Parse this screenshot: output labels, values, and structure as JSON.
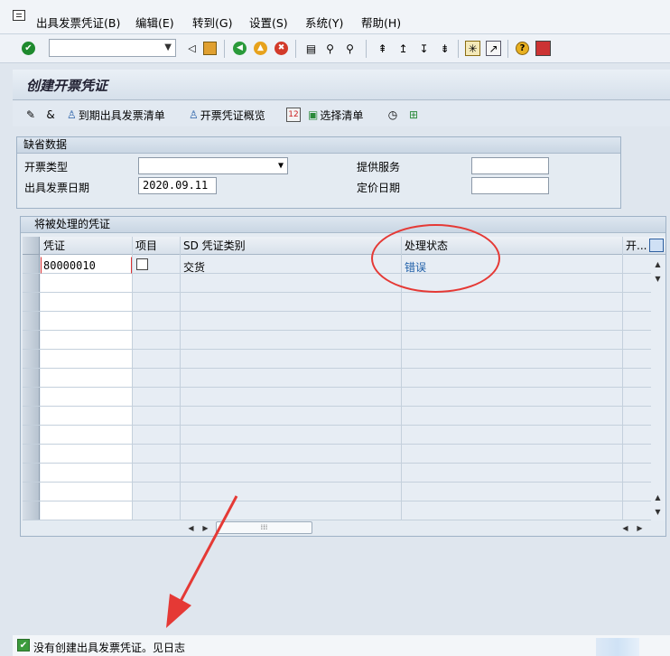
{
  "menu": {
    "items": [
      "出具发票凭证(B)",
      "编辑(E)",
      "转到(G)",
      "设置(S)",
      "系统(Y)",
      "帮助(H)"
    ]
  },
  "system_toolbar": {
    "command_field": "",
    "icons": [
      "enter-icon",
      "back-arrow-icon",
      "save-icon",
      "back-icon",
      "exit-icon",
      "cancel-icon",
      "print-icon",
      "find-icon",
      "find-next-icon",
      "first-page-icon",
      "prev-page-icon",
      "next-page-icon",
      "last-page-icon",
      "new-session-icon",
      "shortcut-icon",
      "help-icon",
      "layout-icon"
    ]
  },
  "title": "创建开票凭证",
  "app_toolbar": {
    "buttons": [
      "到期出具发票清单",
      "开票凭证概览",
      "选择清单"
    ]
  },
  "defaults_group": {
    "title": "缺省数据",
    "invoice_type_label": "开票类型",
    "invoice_type_value": "",
    "billing_date_label": "出具发票日期",
    "billing_date_value": "2020.09.11",
    "service_label": "提供服务",
    "service_value": "",
    "pricing_date_label": "定价日期",
    "pricing_date_value": ""
  },
  "docs_group": {
    "title": "将被处理的凭证",
    "columns": [
      "凭证",
      "项目",
      "SD 凭证类别",
      "处理状态",
      "开..."
    ],
    "rows": [
      {
        "document": "80000010",
        "item": "",
        "category": "交货",
        "status": "错误"
      }
    ]
  },
  "status_bar": {
    "message": "没有创建出具发票凭证。见日志"
  },
  "colors": {
    "status_error_link": "#1f5fa8",
    "annotation": "#e53935"
  }
}
